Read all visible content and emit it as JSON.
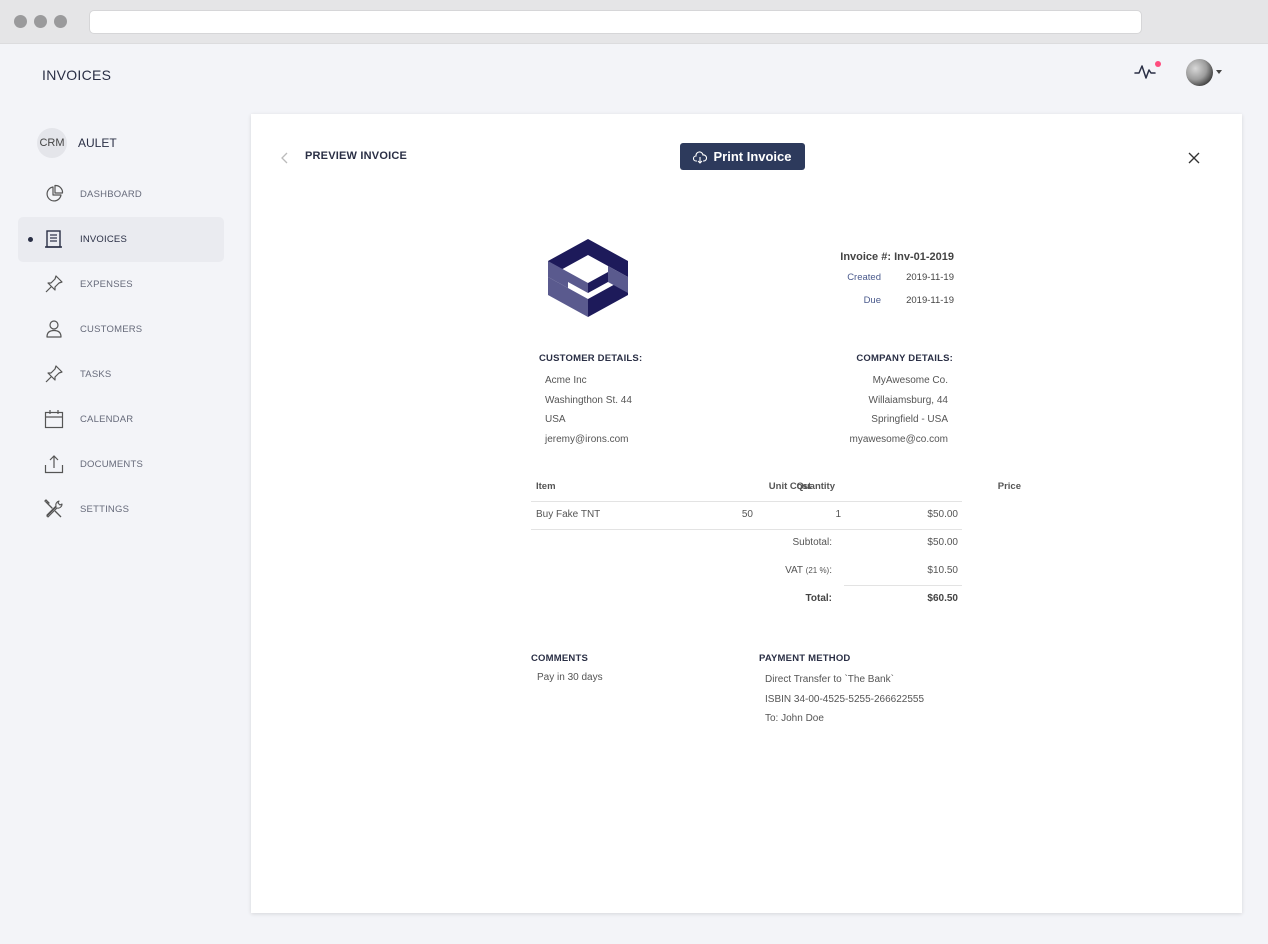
{
  "app": {
    "page_title": "INVOICES"
  },
  "sidebar": {
    "brand_badge": "CRM",
    "brand_name": "AULET",
    "items": [
      {
        "label": "DASHBOARD",
        "icon": "pie-chart-icon",
        "active": false
      },
      {
        "label": "INVOICES",
        "icon": "receipt-icon",
        "active": true
      },
      {
        "label": "EXPENSES",
        "icon": "pin-icon",
        "active": false
      },
      {
        "label": "CUSTOMERS",
        "icon": "user-icon",
        "active": false
      },
      {
        "label": "TASKS",
        "icon": "pin-icon",
        "active": false
      },
      {
        "label": "CALENDAR",
        "icon": "calendar-icon",
        "active": false
      },
      {
        "label": "DOCUMENTS",
        "icon": "upload-icon",
        "active": false
      },
      {
        "label": "SETTINGS",
        "icon": "tools-icon",
        "active": false
      }
    ]
  },
  "panel": {
    "title": "PREVIEW INVOICE",
    "print_label": "Print Invoice"
  },
  "invoice": {
    "number": "Invoice #: Inv-01-2019",
    "created_label": "Created",
    "created_date": "2019-11-19",
    "due_label": "Due",
    "due_date": "2019-11-19",
    "customer": {
      "heading": "CUSTOMER DETAILS:",
      "lines": [
        "Acme Inc",
        "Washingthon St. 44",
        "USA",
        "jeremy@irons.com"
      ]
    },
    "company": {
      "heading": "COMPANY DETAILS:",
      "lines": [
        "MyAwesome Co.",
        "Willaiamsburg, 44",
        "Springfield - USA",
        "myawesome@co.com"
      ]
    },
    "table": {
      "headers": {
        "item": "Item",
        "unit_cost": "Unit Cost",
        "quantity": "Quantity",
        "price": "Price"
      },
      "rows": [
        {
          "item": "Buy Fake TNT",
          "unit_cost": "50",
          "quantity": "1",
          "price": "$50.00"
        }
      ],
      "subtotal_label": "Subtotal:",
      "subtotal_value": "$50.00",
      "vat_label": "VAT",
      "vat_pct": "(21 %)",
      "vat_colon": ":",
      "vat_value": "$10.50",
      "total_label": "Total:",
      "total_value": "$60.50"
    },
    "comments": {
      "heading": "COMMENTS",
      "text": "Pay in 30 days"
    },
    "payment": {
      "heading": "PAYMENT METHOD",
      "lines": [
        "Direct Transfer to `The Bank`",
        "ISBIN 34-00-4525-5255-266622555",
        "To: John Doe"
      ]
    }
  },
  "colors": {
    "accent": "#2d3a5c",
    "notification": "#ff4d7e",
    "logo_dark": "#1d1a5a",
    "logo_light": "#5a5a8e"
  }
}
